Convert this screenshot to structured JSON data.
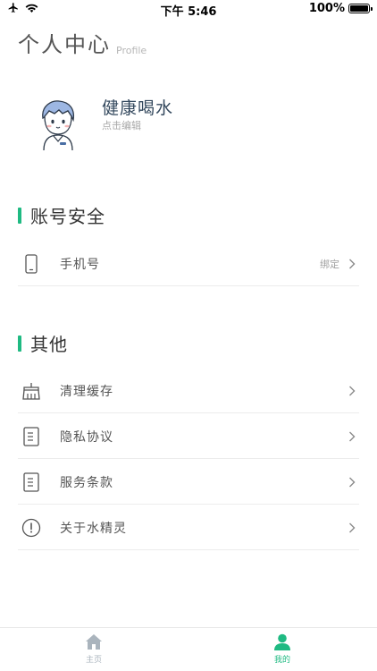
{
  "status": {
    "time": "下午 5:46",
    "battery": "100%",
    "battery_level": 1.0
  },
  "header": {
    "title": "个人中心",
    "subtitle": "Profile"
  },
  "profile": {
    "name": "健康喝水",
    "hint": "点击编辑"
  },
  "sections": [
    {
      "title": "账号安全",
      "items": [
        {
          "label": "手机号",
          "value": "绑定",
          "icon": "phone-icon"
        }
      ]
    },
    {
      "title": "其他",
      "items": [
        {
          "label": "清理缓存",
          "icon": "broom-icon"
        },
        {
          "label": "隐私协议",
          "icon": "document-icon"
        },
        {
          "label": "服务条款",
          "icon": "document-icon"
        },
        {
          "label": "关于水精灵",
          "icon": "info-icon"
        }
      ]
    }
  ],
  "tabbar": {
    "items": [
      {
        "label": "主页",
        "icon": "home-icon",
        "active": false
      },
      {
        "label": "我的",
        "icon": "person-icon",
        "active": true
      }
    ]
  },
  "colors": {
    "accent": "#1fba82",
    "inactive_tab": "#aab4bd",
    "text_dark": "#34495e"
  }
}
